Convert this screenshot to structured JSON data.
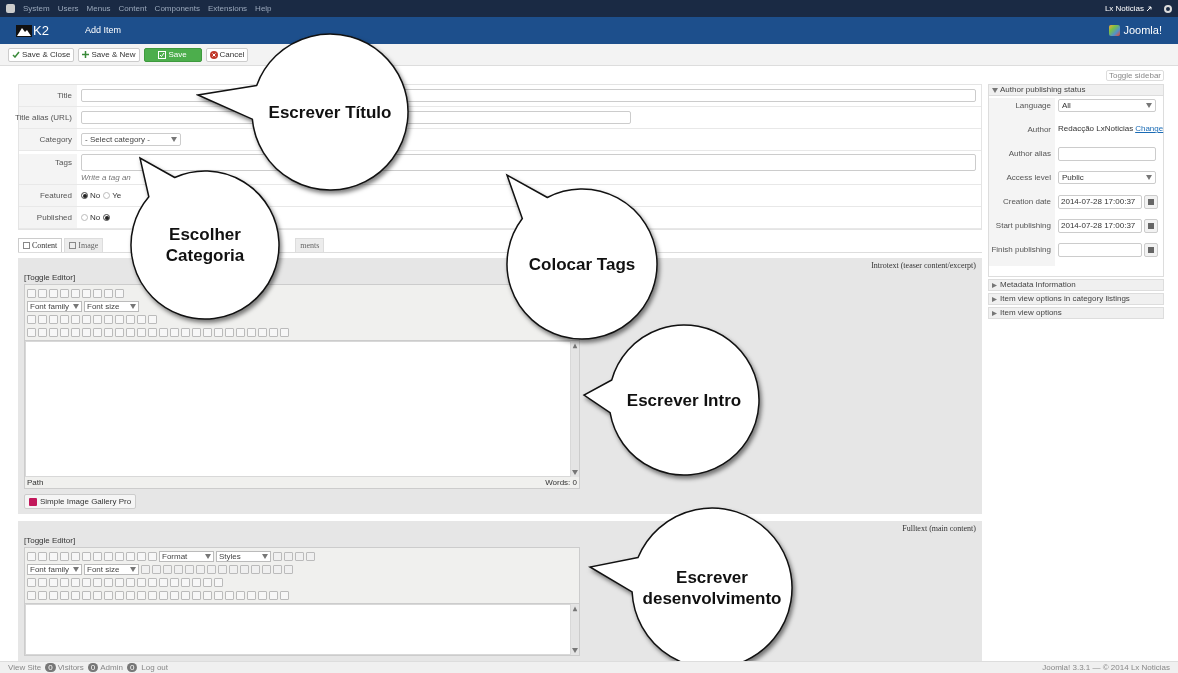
{
  "top_menu": {
    "items": [
      "System",
      "Users",
      "Menus",
      "Content",
      "Components",
      "Extensions",
      "Help"
    ],
    "site": "Lx Noticias"
  },
  "header": {
    "logo": "K2",
    "title": "Add Item",
    "brand": "Joomla!"
  },
  "toolbar": {
    "buttons": [
      {
        "kind": "check",
        "label": "Save & Close"
      },
      {
        "kind": "plus",
        "label": "Save & New"
      },
      {
        "kind": "primary",
        "label": "Save"
      },
      {
        "kind": "cancel",
        "label": "Cancel"
      }
    ],
    "toggle_sidebar": "Toggle sidebar"
  },
  "form": {
    "fields": [
      {
        "kind": "input",
        "label": "Title"
      },
      {
        "kind": "alias",
        "label": "Title alias (URL)"
      },
      {
        "kind": "select",
        "label": "Category",
        "value": "- Select category -"
      },
      {
        "kind": "tags",
        "label": "Tags",
        "hint": "Write a tag an"
      },
      {
        "kind": "radio",
        "label": "Featured",
        "options": [
          {
            "label": "No",
            "selected": true
          },
          {
            "label": "Ye",
            "selected": false
          }
        ]
      },
      {
        "kind": "radio",
        "label": "Published",
        "options": [
          {
            "label": "No",
            "selected": false
          },
          {
            "selected": true
          }
        ]
      }
    ]
  },
  "tabs": [
    {
      "label": "Content",
      "selected": true
    },
    {
      "label": "Image",
      "selected": false
    },
    {
      "label": "ments",
      "selected": false
    }
  ],
  "editors": [
    {
      "caption": "Introtext (teaser content/excerpt)",
      "toggle": "[Toggle Editor]",
      "row_2_selects": [
        "Font family",
        "Font size"
      ],
      "path": "Path",
      "words": "Words: 0",
      "gallery_button": "Simple Image Gallery Pro"
    },
    {
      "caption": "Fulltext (main content)",
      "toggle": "[Toggle Editor]",
      "row_1_selects": [
        "Format",
        "Styles"
      ],
      "row_2_selects": [
        "Font family",
        "Font size"
      ]
    }
  ],
  "sidebar": {
    "panels": [
      {
        "title": "Author publishing status",
        "expanded": true,
        "fields": [
          {
            "kind": "select",
            "label": "Language",
            "value": "All"
          },
          {
            "kind": "text",
            "label": "Author",
            "value": "Redacção LxNoticias",
            "link": "Change"
          },
          {
            "kind": "input",
            "label": "Author alias"
          },
          {
            "kind": "select",
            "label": "Access level",
            "value": "Public"
          },
          {
            "kind": "date",
            "label": "Creation date",
            "value": "2014-07-28 17:00:37"
          },
          {
            "kind": "date",
            "label": "Start publishing",
            "value": "2014-07-28 17:00:37"
          },
          {
            "kind": "date",
            "label": "Finish publishing"
          }
        ]
      },
      {
        "title": "Metadata Information",
        "expanded": false
      },
      {
        "title": "Item view options in category listings",
        "expanded": false
      },
      {
        "title": "Item view options",
        "expanded": false
      }
    ]
  },
  "callouts": [
    "Escrever Título",
    "Escolher Categoria",
    "Colocar Tags",
    "Escrever Intro",
    "Escrever desenvolvimento"
  ],
  "status_bar": {
    "items": [
      {
        "kind": "link",
        "label": "View Site"
      },
      {
        "kind": "count",
        "count": "0",
        "label": "Visitors"
      },
      {
        "kind": "count",
        "count": "0",
        "label": "Admin"
      },
      {
        "kind": "count",
        "count": "0"
      },
      {
        "kind": "link",
        "label": "Log out"
      }
    ],
    "copyright": "Joomla! 3.3.1 — © 2014 Lx Noticias"
  }
}
